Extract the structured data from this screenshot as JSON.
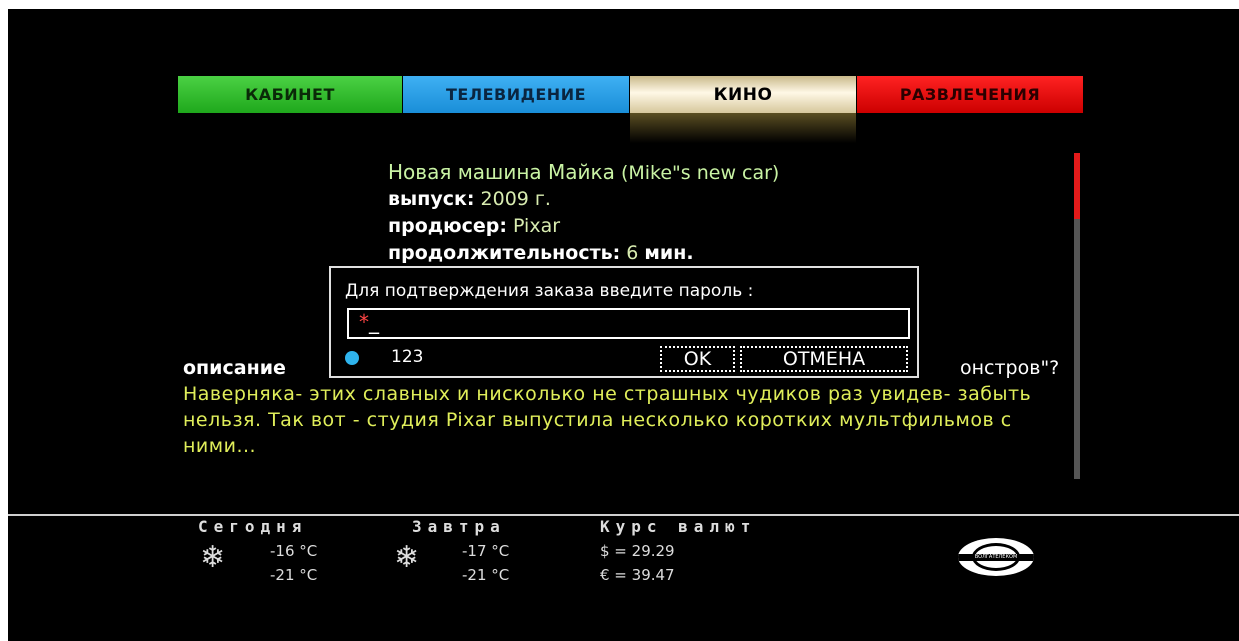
{
  "tabs": [
    {
      "label": "КАБИНЕТ"
    },
    {
      "label": "ТЕЛЕВИДЕНИЕ"
    },
    {
      "label": "КИНО"
    },
    {
      "label": "РАЗВЛЕЧЕНИЯ"
    }
  ],
  "selected_tab": "КИНО",
  "movie": {
    "title_ru": "Новая машина Майка",
    "title_en": "(Mike\"s new car)",
    "release_label": "выпуск:",
    "release_value": "2009 г.",
    "producer_label": "продюсер:",
    "producer_value": "Pixar",
    "duration_label": "продолжительность:",
    "duration_number": "6",
    "duration_unit": "мин.",
    "description_label": "описание",
    "description_visible_tail": "онстров\"?",
    "description_text": "Наверняка- этих славных и нисколько не страшных чудиков раз увидев- забыть нельзя. Так вот - студия Pixar выпустила несколько коротких мультфильмов с ними..."
  },
  "dialog": {
    "prompt": "Для подтверждения заказа введите пароль :",
    "input_value": "*",
    "cursor": "_",
    "hint": "123",
    "ok_label": "OK",
    "cancel_label": "ОТМЕНА"
  },
  "weather": {
    "today_label": "Сегодня",
    "today_day": "-16 °C",
    "today_night": "-21 °C",
    "tomorrow_label": "Завтра",
    "tomorrow_day": "-17 °C",
    "tomorrow_night": "-21 °C"
  },
  "currency": {
    "label": "Курс валют",
    "usd": "$ = 29.29",
    "eur": "€ = 39.47"
  },
  "logo_text": "ВОЛГАТЕЛЕКОМ",
  "icons": {
    "weather_icon": "snowflake-icon",
    "hint_bullet": "dot-icon",
    "logo": "volgatelecom-logo"
  },
  "colors": {
    "tab_cabinet": "#2dbb28",
    "tab_tv": "#2a9fe6",
    "tab_kino": "#fff8e6",
    "tab_fun": "#e41111",
    "scroll_thumb": "#e41a1a",
    "description_text": "#e0ee5a"
  }
}
